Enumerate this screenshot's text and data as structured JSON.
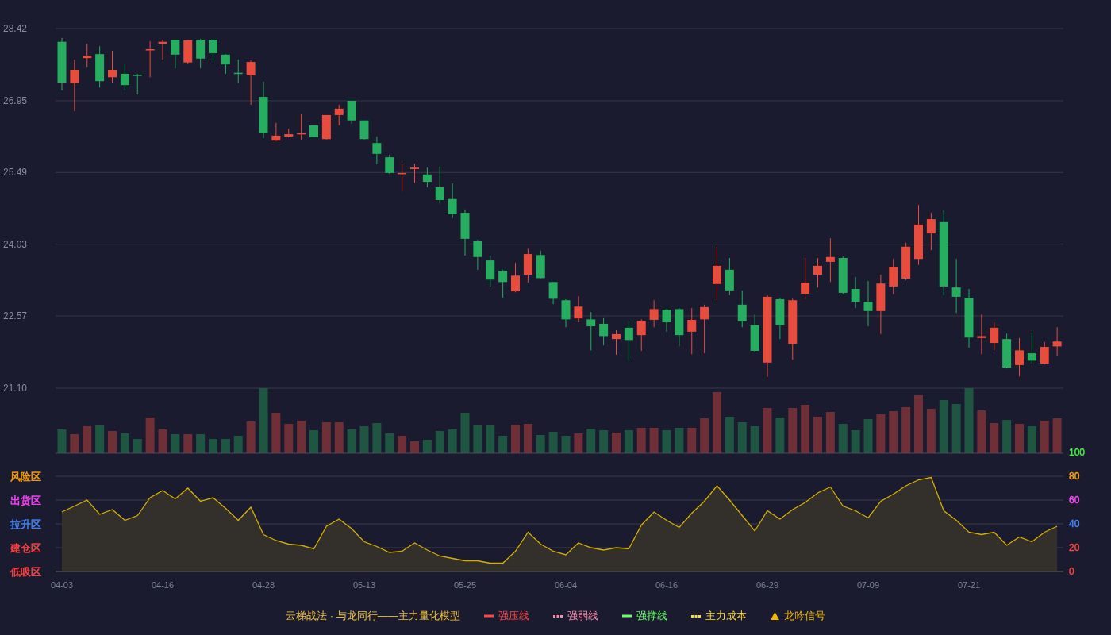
{
  "price_chart": {
    "chart_data": {
      "type": "candlestick",
      "grid": true,
      "ylim": [
        21.1,
        28.42
      ],
      "categories": [
        null,
        null,
        null,
        null,
        null,
        null,
        null,
        null,
        null,
        null,
        null,
        null,
        null,
        null,
        null,
        null,
        null,
        null,
        null,
        null,
        null,
        null,
        null,
        null,
        null,
        null,
        null,
        null,
        null,
        null,
        null,
        null,
        null,
        null,
        null,
        null,
        null,
        null,
        null,
        null,
        null,
        null,
        null,
        null,
        null,
        null,
        null,
        null,
        null,
        null,
        null,
        null,
        null,
        null,
        null,
        null,
        null,
        null,
        null,
        null,
        null,
        null,
        null,
        null,
        null,
        null,
        null,
        null,
        null,
        null,
        null,
        null,
        null,
        null,
        null,
        null,
        null,
        null,
        null,
        null
      ],
      "yticks": [
        {
          "value": 28.42,
          "label": "28.42"
        },
        {
          "value": 26.95,
          "label": "26.95"
        },
        {
          "value": 25.49,
          "label": "25.49"
        },
        {
          "value": 24.03,
          "label": "24.03"
        },
        {
          "value": 22.57,
          "label": "22.57"
        },
        {
          "value": 21.1,
          "label": "21.10"
        }
      ],
      "ohlc": [
        [
          28.15,
          28.23,
          27.16,
          27.32
        ],
        [
          27.31,
          27.79,
          26.74,
          27.58
        ],
        [
          27.82,
          28.11,
          27.63,
          27.87
        ],
        [
          27.9,
          28.06,
          27.22,
          27.35
        ],
        [
          27.43,
          27.97,
          27.32,
          27.58
        ],
        [
          27.5,
          27.71,
          27.16,
          27.27
        ],
        [
          27.48,
          27.5,
          27.08,
          27.47
        ],
        [
          27.98,
          28.16,
          27.43,
          28.0
        ],
        [
          28.11,
          28.19,
          27.79,
          28.15
        ],
        [
          28.19,
          28.19,
          27.61,
          27.89
        ],
        [
          27.73,
          28.19,
          27.71,
          28.18
        ],
        [
          28.19,
          28.21,
          27.61,
          27.81
        ],
        [
          28.19,
          28.21,
          27.73,
          27.92
        ],
        [
          27.89,
          27.9,
          27.5,
          27.69
        ],
        [
          27.52,
          27.79,
          27.31,
          27.5
        ],
        [
          27.47,
          27.77,
          26.87,
          27.74
        ],
        [
          27.03,
          27.34,
          26.19,
          26.29
        ],
        [
          26.14,
          26.5,
          26.13,
          26.24
        ],
        [
          26.22,
          26.38,
          26.21,
          26.27
        ],
        [
          26.27,
          26.68,
          26.16,
          26.29
        ],
        [
          26.45,
          26.45,
          26.21,
          26.21
        ],
        [
          26.17,
          26.66,
          26.16,
          26.66
        ],
        [
          26.66,
          26.87,
          26.45,
          26.79
        ],
        [
          26.95,
          26.95,
          26.48,
          26.55
        ],
        [
          26.55,
          26.55,
          26.16,
          26.17
        ],
        [
          26.09,
          26.22,
          25.66,
          25.87
        ],
        [
          25.8,
          25.85,
          25.46,
          25.48
        ],
        [
          25.46,
          25.66,
          25.12,
          25.48
        ],
        [
          25.56,
          25.67,
          25.28,
          25.59
        ],
        [
          25.45,
          25.59,
          25.19,
          25.3
        ],
        [
          25.19,
          25.61,
          24.86,
          24.93
        ],
        [
          24.95,
          25.27,
          24.56,
          24.64
        ],
        [
          24.67,
          24.74,
          23.8,
          24.14
        ],
        [
          24.09,
          24.12,
          23.51,
          23.77
        ],
        [
          23.7,
          23.8,
          23.17,
          23.31
        ],
        [
          23.49,
          23.51,
          22.94,
          23.26
        ],
        [
          23.07,
          23.65,
          23.05,
          23.39
        ],
        [
          23.41,
          23.94,
          23.25,
          23.83
        ],
        [
          23.81,
          23.9,
          23.33,
          23.34
        ],
        [
          23.26,
          23.26,
          22.81,
          22.92
        ],
        [
          22.89,
          22.91,
          22.34,
          22.5
        ],
        [
          22.52,
          22.97,
          22.44,
          22.76
        ],
        [
          22.5,
          22.65,
          21.87,
          22.36
        ],
        [
          22.41,
          22.54,
          21.97,
          22.16
        ],
        [
          22.1,
          22.28,
          21.78,
          22.2
        ],
        [
          22.33,
          22.46,
          21.66,
          22.08
        ],
        [
          22.18,
          22.5,
          21.86,
          22.47
        ],
        [
          22.49,
          22.89,
          22.34,
          22.71
        ],
        [
          22.7,
          22.71,
          22.25,
          22.44
        ],
        [
          22.71,
          22.73,
          21.95,
          22.18
        ],
        [
          22.25,
          22.73,
          21.79,
          22.49
        ],
        [
          22.5,
          22.8,
          21.81,
          22.75
        ],
        [
          23.22,
          23.98,
          22.89,
          23.59
        ],
        [
          23.51,
          23.75,
          22.99,
          23.09
        ],
        [
          22.8,
          23.09,
          22.34,
          22.46
        ],
        [
          22.38,
          22.6,
          21.84,
          21.86
        ],
        [
          21.62,
          22.99,
          21.33,
          22.96
        ],
        [
          22.91,
          22.94,
          22.1,
          22.38
        ],
        [
          22.0,
          22.92,
          21.68,
          22.89
        ],
        [
          23.02,
          23.75,
          22.92,
          23.25
        ],
        [
          23.41,
          23.75,
          23.15,
          23.59
        ],
        [
          23.67,
          24.15,
          23.26,
          23.77
        ],
        [
          23.75,
          23.78,
          23.01,
          23.04
        ],
        [
          23.12,
          23.36,
          22.73,
          22.86
        ],
        [
          22.86,
          23.28,
          22.36,
          22.67
        ],
        [
          22.67,
          23.41,
          22.2,
          23.23
        ],
        [
          23.17,
          23.73,
          23.01,
          23.57
        ],
        [
          23.33,
          24.06,
          23.3,
          23.98
        ],
        [
          23.73,
          24.83,
          23.61,
          24.43
        ],
        [
          24.25,
          24.67,
          23.91,
          24.54
        ],
        [
          24.48,
          24.72,
          22.99,
          23.17
        ],
        [
          23.15,
          23.73,
          22.63,
          22.96
        ],
        [
          22.94,
          23.12,
          21.92,
          22.13
        ],
        [
          22.12,
          22.6,
          21.79,
          22.16
        ],
        [
          22.02,
          22.44,
          21.87,
          22.33
        ],
        [
          22.1,
          22.21,
          21.5,
          21.52
        ],
        [
          21.57,
          22.12,
          21.34,
          21.87
        ],
        [
          21.81,
          22.23,
          21.6,
          21.66
        ],
        [
          21.6,
          22.04,
          21.58,
          21.94
        ],
        [
          21.95,
          22.34,
          21.76,
          22.05
        ]
      ]
    }
  },
  "indicator": {
    "zones": [
      {
        "label": "风险区",
        "color": "#ffa000"
      },
      {
        "label": "出货区",
        "color": "#ff44ff"
      },
      {
        "label": "拉升区",
        "color": "#4488ff"
      },
      {
        "label": "建仓区",
        "color": "#ff4444"
      },
      {
        "label": "低吸区",
        "color": "#ff4444"
      }
    ],
    "right_ticks": [
      {
        "label": "100",
        "color": "#44ee44"
      },
      {
        "label": "80",
        "color": "#ffa000"
      },
      {
        "label": "60",
        "color": "#ff44ff"
      },
      {
        "label": "40",
        "color": "#4488ff"
      },
      {
        "label": "20",
        "color": "#ff4444"
      },
      {
        "label": "0",
        "color": "#ff4444"
      }
    ],
    "chart_data": {
      "type": "area",
      "grid": true,
      "ylim": [
        0,
        100
      ],
      "categories": [
        "04-03",
        null,
        null,
        null,
        null,
        null,
        null,
        null,
        "04-16",
        null,
        null,
        null,
        null,
        null,
        null,
        null,
        "04-28",
        null,
        null,
        null,
        null,
        null,
        null,
        null,
        "05-13",
        null,
        null,
        null,
        null,
        null,
        null,
        null,
        "05-25",
        null,
        null,
        null,
        null,
        null,
        null,
        null,
        "06-04",
        null,
        null,
        null,
        null,
        null,
        null,
        null,
        "06-16",
        null,
        null,
        null,
        null,
        null,
        null,
        null,
        "06-29",
        null,
        null,
        null,
        null,
        null,
        null,
        null,
        "07-09",
        null,
        null,
        null,
        null,
        null,
        null,
        null,
        "07-21",
        null,
        null,
        null,
        null,
        null,
        null,
        null
      ],
      "yticks": [
        100,
        80,
        60,
        40,
        20,
        0
      ],
      "series": [
        {
          "color": "#d4b000",
          "values": [
            50,
            55,
            60,
            48,
            52,
            43,
            47,
            62,
            68,
            61,
            70,
            59,
            62,
            53,
            43,
            54,
            31,
            26,
            23,
            22,
            19,
            38,
            44,
            36,
            25,
            21,
            16,
            17,
            24,
            18,
            13,
            11,
            9,
            9,
            7,
            7,
            17,
            33,
            23,
            17,
            14,
            24,
            20,
            18,
            20,
            19,
            39,
            50,
            43,
            37,
            49,
            59,
            72,
            60,
            47,
            34,
            51,
            44,
            52,
            58,
            66,
            71,
            55,
            51,
            45,
            59,
            65,
            72,
            77,
            79,
            51,
            43,
            33,
            31,
            33,
            22,
            29,
            25,
            33,
            38
          ]
        }
      ]
    }
  },
  "legend": {
    "title": "云梯战法 · 与龙同行——主力量化模型",
    "items": [
      {
        "label": "强压线",
        "kind": "solid",
        "color": "#ff4444"
      },
      {
        "label": "强弱线",
        "kind": "dashed",
        "color": "#ff88aa"
      },
      {
        "label": "强撑线",
        "kind": "solid",
        "color": "#66ff66"
      },
      {
        "label": "主力成本",
        "kind": "dashed",
        "color": "#ffdd33"
      },
      {
        "label": "龙吟信号",
        "kind": "triangle",
        "color": "#f5b800"
      }
    ]
  }
}
